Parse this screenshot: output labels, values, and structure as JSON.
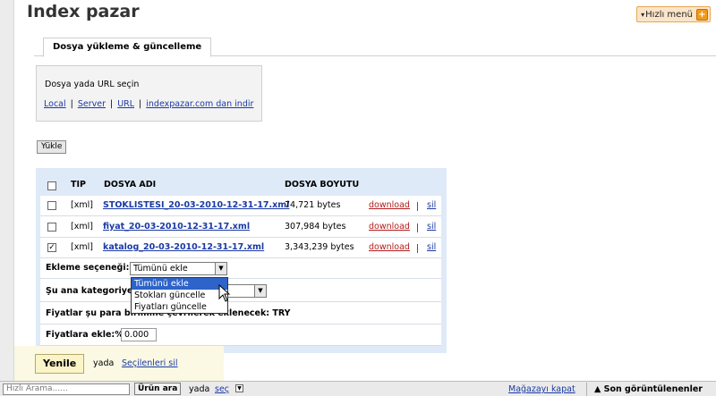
{
  "page": {
    "title": "Index pazar",
    "quick_menu_label": "Hızlı menü"
  },
  "tab": {
    "label": "Dosya yükleme & güncelleme"
  },
  "upload": {
    "prompt": "Dosya yada URL seçin",
    "links": [
      "Local",
      "Server",
      "URL",
      "indexpazar.com dan indir"
    ],
    "button_label": "Yükle"
  },
  "table": {
    "headers": {
      "tip": "TIP",
      "name": "DOSYA ADI",
      "size": "DOSYA BOYUTU"
    },
    "rows": [
      {
        "checked": false,
        "type": "[xml]",
        "name": "STOKLISTESI_20-03-2010-12-31-17.xml",
        "size": "74,721 bytes",
        "download": "download",
        "delete": "sil"
      },
      {
        "checked": false,
        "type": "[xml]",
        "name": "fiyat_20-03-2010-12-31-17.xml",
        "size": "307,984 bytes",
        "download": "download",
        "delete": "sil"
      },
      {
        "checked": true,
        "type": "[xml]",
        "name": "katalog_20-03-2010-12-31-17.xml",
        "size": "3,343,239 bytes",
        "download": "download",
        "delete": "sil"
      }
    ]
  },
  "options": {
    "add_option_label": "Ekleme seçeneği:",
    "add_option_value": "Tümünü ekle",
    "add_option_choices": [
      "Tümünü ekle",
      "Stokları güncelle",
      "Fiyatları güncelle"
    ],
    "category_label": "Şu ana kategoriye",
    "currency_label": "Fiyatlar şu para birimine çevrilerek eklenecek: TRY",
    "price_add_label": "Fiyatlara ekle:%",
    "price_add_value": "0.000"
  },
  "actions": {
    "refresh_label": "Yenile",
    "or_label": "yada",
    "delete_selected_label": "Seçilenleri sil"
  },
  "statusbar": {
    "search_placeholder": "Hızlı Arama......",
    "search_button": "Ürün ara",
    "or_label": "yada",
    "select_label": "seç",
    "close_store_label": "Mağazayı kapat",
    "recently_viewed_label": "▲ Son görüntülenenler"
  }
}
